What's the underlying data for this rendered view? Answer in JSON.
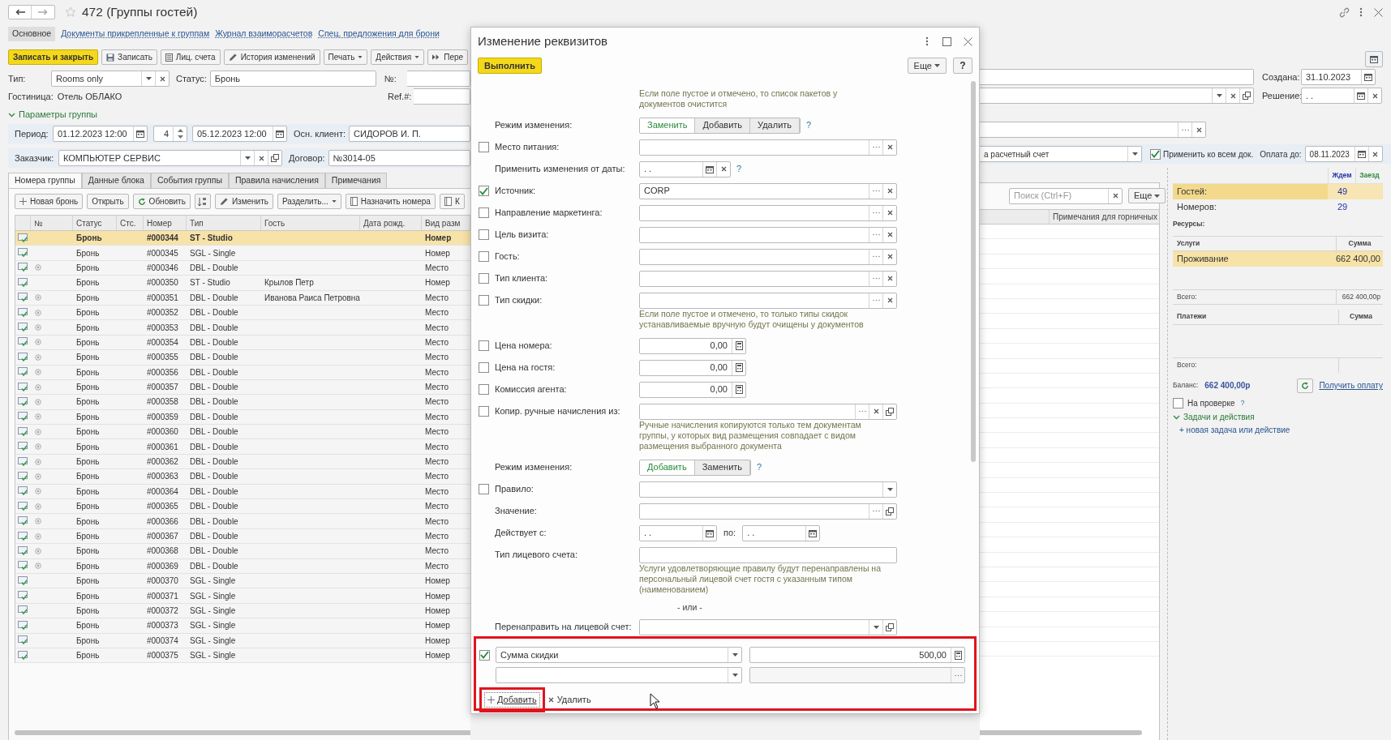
{
  "page": {
    "title": "472 (Группы гостей)"
  },
  "form_tabs": [
    {
      "label": "Основное",
      "selected": true
    },
    {
      "label": "Документы прикрепленные к группам",
      "selected": false
    },
    {
      "label": "Журнал взаиморасчетов",
      "selected": false
    },
    {
      "label": "Спец. предложения для брони",
      "selected": false
    }
  ],
  "toolbar": [
    {
      "kind": "primary",
      "label": "Записать и закрыть"
    },
    {
      "kind": "button",
      "label": "Записать"
    },
    {
      "kind": "button",
      "label": "Лиц. счета"
    },
    {
      "kind": "button",
      "label": "История изменений"
    },
    {
      "kind": "button",
      "label": "Печать",
      "dropdown": true
    },
    {
      "kind": "button",
      "label": "Действия",
      "dropdown": true
    },
    {
      "kind": "button",
      "label": "Пере"
    }
  ],
  "fields": {
    "type": {
      "label": "Тип:",
      "value": "Rooms only"
    },
    "status": {
      "label": "Статус:",
      "value": "Бронь"
    },
    "number": {
      "label": "№:"
    },
    "hotel": {
      "label": "Гостиница:",
      "value": "Отель ОБЛАКО"
    },
    "ref": {
      "label": "Ref.#:"
    },
    "group_params": {
      "label": "Параметры группы",
      "expanded": true
    },
    "period": {
      "label": "Период:",
      "from": "01.12.2023 12:00",
      "nights": "4",
      "to": "05.12.2023 12:00"
    },
    "main_client": {
      "label": "Осн. клиент:",
      "value": "СИДОРОВ И. П."
    },
    "customer": {
      "label": "Заказчик:",
      "value": "КОМПЬЮТЕР СЕРВИС"
    },
    "contract": {
      "label": "Договор:",
      "value": "№3014-05"
    },
    "created": {
      "label": "Создана:",
      "value": "31.10.2023"
    },
    "decision": {
      "label": "Решение:",
      "value": ". ."
    },
    "payment_method": {
      "value": "а расчетный счет"
    },
    "apply_all": {
      "label": "Применить ко всем док.",
      "checked": true
    },
    "pay_until": {
      "label": "Оплата до:",
      "value": "08.11.2023"
    }
  },
  "tabs": [
    {
      "label": "Номера группы",
      "selected": true
    },
    {
      "label": "Данные блока",
      "selected": false
    },
    {
      "label": "События группы",
      "selected": false
    },
    {
      "label": "Правила начисления",
      "selected": false
    },
    {
      "label": "Примечания",
      "selected": false
    }
  ],
  "group_toolbar": [
    {
      "kind": "button",
      "label": "Новая бронь"
    },
    {
      "kind": "button",
      "label": "Открыть"
    },
    {
      "kind": "button",
      "label": "Обновить"
    },
    {
      "kind": "sort"
    },
    {
      "kind": "button",
      "label": "Изменить"
    },
    {
      "kind": "button",
      "label": "Разделить...",
      "dropdown": true
    },
    {
      "kind": "button",
      "label": "Назначить номера"
    },
    {
      "kind": "button",
      "label": "К"
    }
  ],
  "search": {
    "placeholder": "Поиск (Ctrl+F)"
  },
  "table_more": "Еще",
  "table": {
    "columns": [
      "№",
      "Статус",
      "Стс.",
      "Номер",
      "Тип",
      "Гость",
      "Дата рожд.",
      "Вид разм",
      "Примечания для горничных"
    ],
    "rows": [
      {
        "status": "Бронь",
        "number": "#000344",
        "type": "ST - Studio",
        "placement": "Номер",
        "shared": false,
        "selected": true
      },
      {
        "status": "Бронь",
        "number": "#000345",
        "type": "SGL - Single",
        "placement": "Номер",
        "shared": false,
        "selected": false
      },
      {
        "status": "Бронь",
        "number": "#000346",
        "type": "DBL - Double",
        "placement": "Место",
        "shared": true,
        "selected": false
      },
      {
        "status": "Бронь",
        "number": "#000350",
        "type": "ST - Studio",
        "guest": "Крылов Петр",
        "placement": "Номер",
        "shared": false,
        "selected": false
      },
      {
        "status": "Бронь",
        "number": "#000351",
        "type": "DBL - Double",
        "guest": "Иванова Раиса Петровна",
        "placement": "Место",
        "shared": true,
        "selected": false
      },
      {
        "status": "Бронь",
        "number": "#000352",
        "type": "DBL - Double",
        "placement": "Место",
        "shared": true,
        "selected": false
      },
      {
        "status": "Бронь",
        "number": "#000353",
        "type": "DBL - Double",
        "placement": "Место",
        "shared": true,
        "selected": false
      },
      {
        "status": "Бронь",
        "number": "#000354",
        "type": "DBL - Double",
        "placement": "Место",
        "shared": true,
        "selected": false
      },
      {
        "status": "Бронь",
        "number": "#000355",
        "type": "DBL - Double",
        "placement": "Место",
        "shared": true,
        "selected": false
      },
      {
        "status": "Бронь",
        "number": "#000356",
        "type": "DBL - Double",
        "placement": "Место",
        "shared": true,
        "selected": false
      },
      {
        "status": "Бронь",
        "number": "#000357",
        "type": "DBL - Double",
        "placement": "Место",
        "shared": true,
        "selected": false
      },
      {
        "status": "Бронь",
        "number": "#000358",
        "type": "DBL - Double",
        "placement": "Место",
        "shared": true,
        "selected": false
      },
      {
        "status": "Бронь",
        "number": "#000359",
        "type": "DBL - Double",
        "placement": "Место",
        "shared": true,
        "selected": false
      },
      {
        "status": "Бронь",
        "number": "#000360",
        "type": "DBL - Double",
        "placement": "Место",
        "shared": true,
        "selected": false
      },
      {
        "status": "Бронь",
        "number": "#000361",
        "type": "DBL - Double",
        "placement": "Место",
        "shared": true,
        "selected": false
      },
      {
        "status": "Бронь",
        "number": "#000362",
        "type": "DBL - Double",
        "placement": "Место",
        "shared": true,
        "selected": false
      },
      {
        "status": "Бронь",
        "number": "#000363",
        "type": "DBL - Double",
        "placement": "Место",
        "shared": true,
        "selected": false
      },
      {
        "status": "Бронь",
        "number": "#000364",
        "type": "DBL - Double",
        "placement": "Место",
        "shared": true,
        "selected": false
      },
      {
        "status": "Бронь",
        "number": "#000365",
        "type": "DBL - Double",
        "placement": "Место",
        "shared": true,
        "selected": false
      },
      {
        "status": "Бронь",
        "number": "#000366",
        "type": "DBL - Double",
        "placement": "Место",
        "shared": true,
        "selected": false
      },
      {
        "status": "Бронь",
        "number": "#000367",
        "type": "DBL - Double",
        "placement": "Место",
        "shared": true,
        "selected": false
      },
      {
        "status": "Бронь",
        "number": "#000368",
        "type": "DBL - Double",
        "placement": "Место",
        "shared": true,
        "selected": false
      },
      {
        "status": "Бронь",
        "number": "#000369",
        "type": "DBL - Double",
        "placement": "Место",
        "shared": true,
        "selected": false
      },
      {
        "status": "Бронь",
        "number": "#000370",
        "type": "SGL - Single",
        "placement": "Номер",
        "shared": false,
        "selected": false
      },
      {
        "status": "Бронь",
        "number": "#000371",
        "type": "SGL - Single",
        "placement": "Номер",
        "shared": false,
        "selected": false
      },
      {
        "status": "Бронь",
        "number": "#000372",
        "type": "SGL - Single",
        "placement": "Номер",
        "shared": false,
        "selected": false
      },
      {
        "status": "Бронь",
        "number": "#000373",
        "type": "SGL - Single",
        "placement": "Номер",
        "shared": false,
        "selected": false
      },
      {
        "status": "Бронь",
        "number": "#000374",
        "type": "SGL - Single",
        "placement": "Номер",
        "shared": false,
        "selected": false
      },
      {
        "status": "Бронь",
        "number": "#000375",
        "type": "SGL - Single",
        "placement": "Номер",
        "shared": false,
        "selected": false
      }
    ]
  },
  "summary": {
    "columns": [
      "Ждем",
      "Заезд"
    ],
    "rows": [
      {
        "label": "Гостей:",
        "waiting": "49",
        "selected": true
      },
      {
        "label": "Номеров:",
        "waiting": "29",
        "selected": false
      }
    ],
    "resources_label": "Ресурсы:",
    "services": {
      "columns": [
        "Услуги",
        "Сумма"
      ],
      "rows": [
        {
          "name": "Проживание",
          "sum": "662 400,00",
          "selected": true
        }
      ],
      "total_label": "Всего:",
      "total": "662 400,00р"
    },
    "payments": {
      "columns": [
        "Платежи",
        "Сумма"
      ],
      "total_label": "Всего:"
    },
    "balance": {
      "label": "Баланс:",
      "value": "662 400,00р"
    },
    "get_payment": "Получить оплату",
    "on_check": {
      "label": "На проверке",
      "checked": false,
      "help": "?"
    },
    "tasks": {
      "label": "Задачи и действия",
      "expanded": true,
      "new_link": "+ новая задача или действие"
    }
  },
  "dialog": {
    "title": "Изменение реквизитов",
    "run": "Выполнить",
    "more": "Еще",
    "help": "?",
    "rows": [
      {
        "kind": "hint",
        "text": "Если поле пустое и отмечено, то список пакетов у документов очистится"
      },
      {
        "kind": "mode",
        "label": "Режим изменения:",
        "options": [
          {
            "label": "Заменить",
            "selected": true
          },
          {
            "label": "Добавить",
            "selected": false
          },
          {
            "label": "Удалить",
            "selected": false
          }
        ],
        "help": "?"
      },
      {
        "kind": "field",
        "label": "Место питания:",
        "checked": false,
        "choose": true,
        "clear": true
      },
      {
        "kind": "date",
        "label": "Применить изменения от даты:",
        "value": ". .",
        "clear": true,
        "help": "?"
      },
      {
        "kind": "field",
        "label": "Источник:",
        "checked": true,
        "value": "CORP",
        "choose": true,
        "clear": true
      },
      {
        "kind": "field",
        "label": "Направление маркетинга:",
        "checked": false,
        "choose": true,
        "clear": true
      },
      {
        "kind": "field",
        "label": "Цель визита:",
        "checked": false,
        "choose": true,
        "clear": true
      },
      {
        "kind": "field",
        "label": "Гость:",
        "checked": false,
        "choose": true,
        "clear": true
      },
      {
        "kind": "field",
        "label": "Тип клиента:",
        "checked": false,
        "choose": true,
        "clear": true
      },
      {
        "kind": "field",
        "label": "Тип скидки:",
        "checked": false,
        "choose": true,
        "clear": true
      },
      {
        "kind": "hint",
        "text": "Если поле пустое и отмечено, то только типы скидок устанавливаемые вручную будут очищены у документов"
      },
      {
        "kind": "number",
        "label": "Цена номера:",
        "checked": false,
        "value": "0,00"
      },
      {
        "kind": "number",
        "label": "Цена на гостя:",
        "checked": false,
        "value": "0,00"
      },
      {
        "kind": "number",
        "label": "Комиссия агента:",
        "checked": false,
        "value": "0,00"
      },
      {
        "kind": "field",
        "label": "Копир. ручные начисления из:",
        "checked": false,
        "choose": true,
        "clear": true,
        "open": true
      },
      {
        "kind": "hint",
        "text": "Ручные начисления копируются только тем документам группы, у которых вид размещения совпадает с видом размещения выбранного документа"
      },
      {
        "kind": "mode",
        "label": "Режим изменения:",
        "options": [
          {
            "label": "Добавить",
            "selected": true
          },
          {
            "label": "Заменить",
            "selected": false
          }
        ],
        "help": "?"
      },
      {
        "kind": "field",
        "label": "Правило:",
        "checked": false,
        "dropdown": true
      },
      {
        "kind": "field",
        "label": "Значение:",
        "choose": true,
        "open": true
      },
      {
        "kind": "range",
        "label": "Действует с:",
        "from": ". .",
        "to_label": "по:",
        "to": ". ."
      },
      {
        "kind": "field",
        "label": "Тип лицевого счета:"
      },
      {
        "kind": "hint",
        "text": "Услуги удовлетворяющие правилу будут перенаправлены на персональный лицевой счет гостя с указанным типом (наименованием)"
      },
      {
        "kind": "separator",
        "text": "- или -"
      },
      {
        "kind": "field",
        "label": "Перенаправить на лицевой счет:",
        "dropdown": true,
        "open": true
      }
    ],
    "bottom": {
      "highlighted": true,
      "lines": [
        {
          "checked": true,
          "name": "Сумма скидки",
          "value": "500,00",
          "value_disabled": false
        },
        {
          "value_disabled": true
        }
      ],
      "add": {
        "label": "Добавить",
        "highlighted": true
      },
      "remove": "Удалить"
    }
  }
}
